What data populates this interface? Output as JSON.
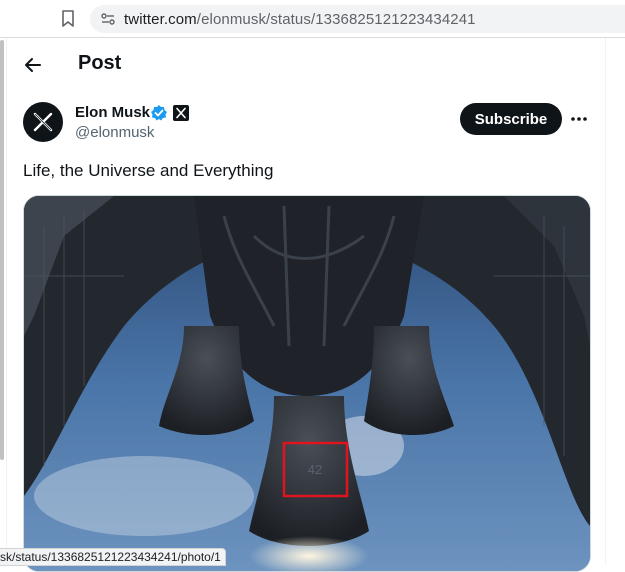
{
  "browser": {
    "url_host": "twitter.com",
    "url_path": "/elonmusk/status/1336825121223434241",
    "status_url": "sk/status/1336825121223434241/photo/1"
  },
  "header": {
    "title": "Post"
  },
  "post": {
    "author_name": "Elon Musk",
    "author_handle": "@elonmusk",
    "subscribe_label": "Subscribe",
    "text": "Life, the Universe and Everything",
    "image_overlay_text": "42"
  },
  "colors": {
    "accent": "#1d9bf0",
    "button_bg": "#0f1419",
    "highlight_box": "#e0141e"
  }
}
